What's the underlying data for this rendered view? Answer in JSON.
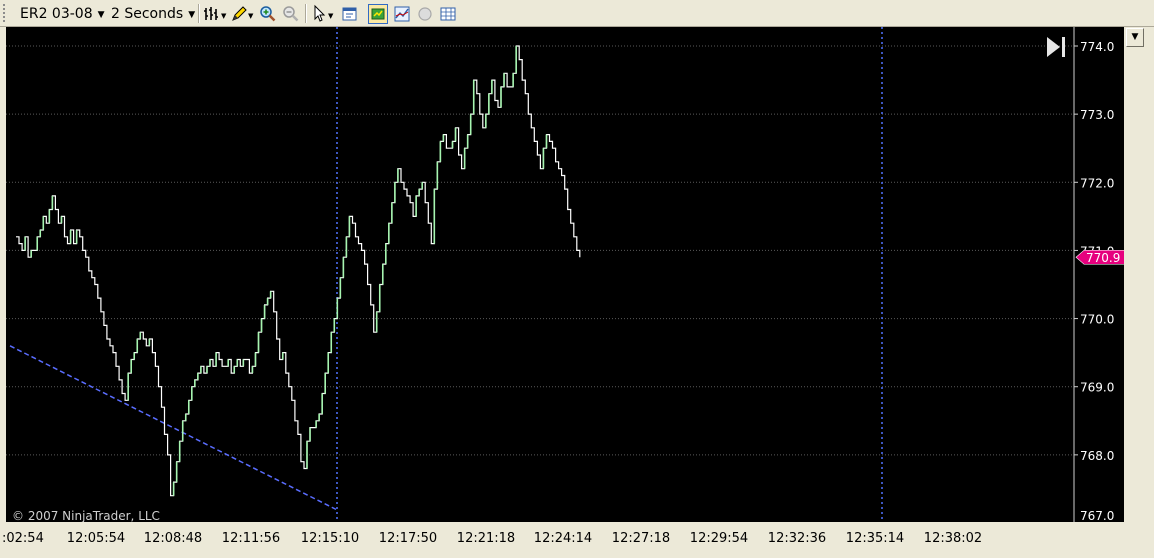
{
  "toolbar": {
    "instrument": "ER2 03-08",
    "interval": "2 Seconds",
    "icons": [
      "bar-style-icon",
      "pencil-icon",
      "zoom-in-icon",
      "zoom-out-icon",
      "cursor-icon",
      "properties-icon",
      "data-box-icon",
      "indicators-icon",
      "strategies-icon",
      "grid-icon"
    ]
  },
  "chart_data": {
    "type": "line",
    "title": "",
    "xlabel": "",
    "ylabel": "",
    "ylim": [
      767.0,
      774.0
    ],
    "y_ticks": [
      "774.0",
      "773.0",
      "772.0",
      "771.0",
      "770.0",
      "769.0",
      "768.0",
      "767.0"
    ],
    "x_ticks": [
      ":02:54",
      "12:05:54",
      "12:08:48",
      "12:11:56",
      "12:15:10",
      "12:17:50",
      "12:21:18",
      "12:24:14",
      "12:27:18",
      "12:29:54",
      "12:32:36",
      "12:35:14",
      "12:38:02"
    ],
    "series": [
      {
        "x_index": [
          0,
          0.15,
          0.3,
          0.45,
          0.6,
          0.75,
          0.9,
          1.05,
          1.2,
          1.35,
          1.5,
          1.65,
          1.8,
          1.95,
          2.1,
          2.25,
          2.4,
          2.55,
          2.7,
          2.85,
          3.0,
          3.15,
          3.3,
          3.45,
          3.6,
          3.75,
          3.9,
          4.05,
          4.2,
          4.35,
          4.5,
          4.65,
          4.8,
          4.95,
          5.1,
          5.25,
          5.4,
          5.55,
          5.7,
          5.85,
          6.0,
          6.15,
          6.3,
          6.45,
          6.6,
          6.75,
          6.9,
          7.05,
          7.2,
          7.35,
          7.5,
          7.65,
          7.8,
          7.95,
          8.1,
          8.25,
          8.4,
          8.55,
          8.7,
          8.85,
          9.0,
          9.15,
          9.3,
          9.45,
          9.6,
          9.75,
          9.9,
          10.05,
          10.2,
          10.35,
          10.5,
          10.65,
          10.8,
          10.95,
          11.1,
          11.25,
          11.4,
          11.55,
          11.7,
          11.85,
          12.0,
          12.15,
          12.3,
          12.45,
          12.6,
          12.75,
          12.9,
          13.05,
          13.2,
          13.35,
          13.5,
          13.65,
          13.8,
          13.95,
          14.1,
          14.25,
          14.4,
          14.55,
          14.7,
          14.85,
          15.0,
          15.15,
          15.3,
          15.45,
          15.6,
          15.75,
          15.9,
          16.05,
          16.2,
          16.35,
          16.5,
          16.65,
          16.8,
          16.95,
          17.1,
          17.25,
          17.4,
          17.55,
          17.7,
          17.85,
          18.0,
          18.15,
          18.3,
          18.45,
          18.6,
          18.75,
          18.9,
          19.05,
          19.2,
          19.35,
          19.5,
          19.65,
          19.8,
          19.95,
          20.1,
          20.25,
          20.4,
          20.55,
          20.7,
          20.85,
          21.0,
          21.15,
          21.3,
          21.45,
          21.6,
          21.75,
          21.9,
          22.05,
          22.2,
          22.35,
          22.5,
          22.65,
          22.8,
          22.95,
          23.1,
          23.25,
          23.4,
          23.55,
          23.7,
          23.85,
          24.0,
          24.15,
          24.3,
          24.45,
          24.6,
          24.75,
          24.9,
          25.05,
          25.2,
          25.35,
          25.5,
          25.65,
          25.8,
          25.95,
          26.1,
          26.25,
          26.4,
          26.55,
          26.7,
          26.85,
          27.0,
          27.15,
          27.3,
          27.45,
          27.6,
          27.75,
          27.9,
          28.05,
          28.2,
          28.35,
          28.5,
          28.65,
          28.8,
          28.95,
          29.1,
          29.25,
          29.4,
          29.55,
          29.7,
          29.85,
          30.0,
          30.15,
          30.3,
          30.45,
          30.6,
          30.75,
          30.9,
          31.05,
          31.2,
          31.35,
          31.5,
          31.65,
          31.8,
          31.95,
          32.1,
          32.25,
          32.4,
          32.55,
          32.7,
          32.85,
          33.0,
          33.15,
          33.3,
          33.45,
          33.6,
          33.75,
          33.9,
          34.05,
          34.2,
          34.35,
          34.5,
          34.65,
          34.8,
          34.95,
          35.1,
          35.25,
          35.4,
          35.55,
          35.7,
          35.85,
          36.0,
          36.15,
          36.3,
          36.45,
          36.6,
          36.75,
          36.9,
          37.05,
          37.2,
          37.35,
          37.5,
          37.65,
          37.8,
          37.95,
          38.1,
          38.25,
          38.4,
          38.55,
          38.7,
          38.85,
          39.0,
          39.15,
          39.3,
          39.45,
          39.6,
          39.75,
          39.9,
          40.05,
          40.2,
          40.35,
          40.5,
          40.65,
          40.8,
          40.95,
          41.1,
          41.25,
          41.4,
          41.55,
          41.7,
          41.85,
          42.0,
          42.15,
          42.3,
          42.45,
          42.6,
          42.75,
          42.9,
          43.05,
          43.2,
          43.35,
          43.5,
          43.65,
          43.8,
          43.95,
          44.1,
          44.25,
          44.4,
          44.55,
          44.7,
          44.85,
          45.0,
          45.15,
          45.3,
          45.45,
          45.6,
          45.75,
          45.9,
          46.05,
          46.2,
          46.35,
          46.5,
          46.65,
          46.8,
          46.95,
          47.1,
          47.25,
          47.4,
          47.55,
          47.7,
          47.85,
          48.0
        ],
        "values": [
          771.2,
          771.1,
          771.0,
          771.2,
          770.9,
          771.0,
          771.0,
          771.2,
          771.3,
          771.5,
          771.4,
          771.6,
          771.8,
          771.6,
          771.4,
          771.5,
          771.2,
          771.1,
          771.3,
          771.1,
          771.3,
          771.2,
          771.0,
          770.9,
          770.7,
          770.6,
          770.5,
          770.3,
          770.1,
          769.9,
          769.7,
          769.6,
          769.5,
          769.3,
          769.1,
          768.9,
          768.8,
          769.2,
          769.4,
          769.5,
          769.7,
          769.8,
          769.7,
          769.6,
          769.7,
          769.5,
          769.3,
          769.0,
          768.7,
          768.3,
          768.0,
          767.4,
          767.6,
          767.9,
          768.2,
          768.5,
          768.6,
          768.8,
          769.0,
          769.1,
          769.2,
          769.3,
          769.2,
          769.3,
          769.4,
          769.3,
          769.5,
          769.4,
          769.3,
          769.3,
          769.4,
          769.2,
          769.3,
          769.4,
          769.3,
          769.4,
          769.4,
          769.2,
          769.3,
          769.5,
          769.8,
          770.0,
          770.2,
          770.3,
          770.4,
          770.1,
          769.7,
          769.4,
          769.5,
          769.2,
          769.0,
          768.8,
          768.5,
          768.3,
          767.9,
          767.8,
          768.2,
          768.4,
          768.4,
          768.5,
          768.6,
          768.9,
          769.2,
          769.5,
          769.8,
          770.0,
          770.3,
          770.6,
          770.9,
          771.2,
          771.5,
          771.4,
          771.2,
          771.1,
          771.0,
          770.8,
          770.5,
          770.2,
          769.8,
          770.1,
          770.5,
          770.8,
          771.1,
          771.4,
          771.7,
          772.0,
          772.2,
          772.0,
          771.9,
          771.8,
          771.7,
          771.5,
          771.8,
          771.9,
          772.0,
          771.7,
          771.4,
          771.1,
          771.9,
          772.3,
          772.6,
          772.7,
          772.5,
          772.5,
          772.6,
          772.8,
          772.4,
          772.2,
          772.5,
          772.7,
          773.0,
          773.5,
          773.3,
          773.0,
          772.8,
          773.0,
          773.3,
          773.5,
          773.2,
          773.1,
          773.4,
          773.6,
          773.4,
          773.4,
          773.6,
          774.0,
          773.8,
          773.5,
          773.3,
          773.0,
          772.8,
          772.6,
          772.4,
          772.2,
          772.5,
          772.7,
          772.6,
          772.5,
          772.3,
          772.2,
          772.1,
          771.9,
          771.6,
          771.4,
          771.2,
          771.0,
          770.9
        ],
        "x_range": [
          0,
          48
        ]
      }
    ],
    "last_price_label": "770.9",
    "last_price_value": 770.9,
    "copyright": "© 2007 NinjaTrader, LLC",
    "grid": true,
    "vertical_markers_at_tick": [
      "12:15:10",
      "12:35:14"
    ],
    "colors": {
      "background": "#000000",
      "price_line": "#ffffff",
      "up_tick": "#a6f5b0",
      "grid": "#5a5a5a",
      "marker": "#5073ff",
      "trendline": "#5a6dff",
      "price_tag": "#e6007e"
    }
  }
}
